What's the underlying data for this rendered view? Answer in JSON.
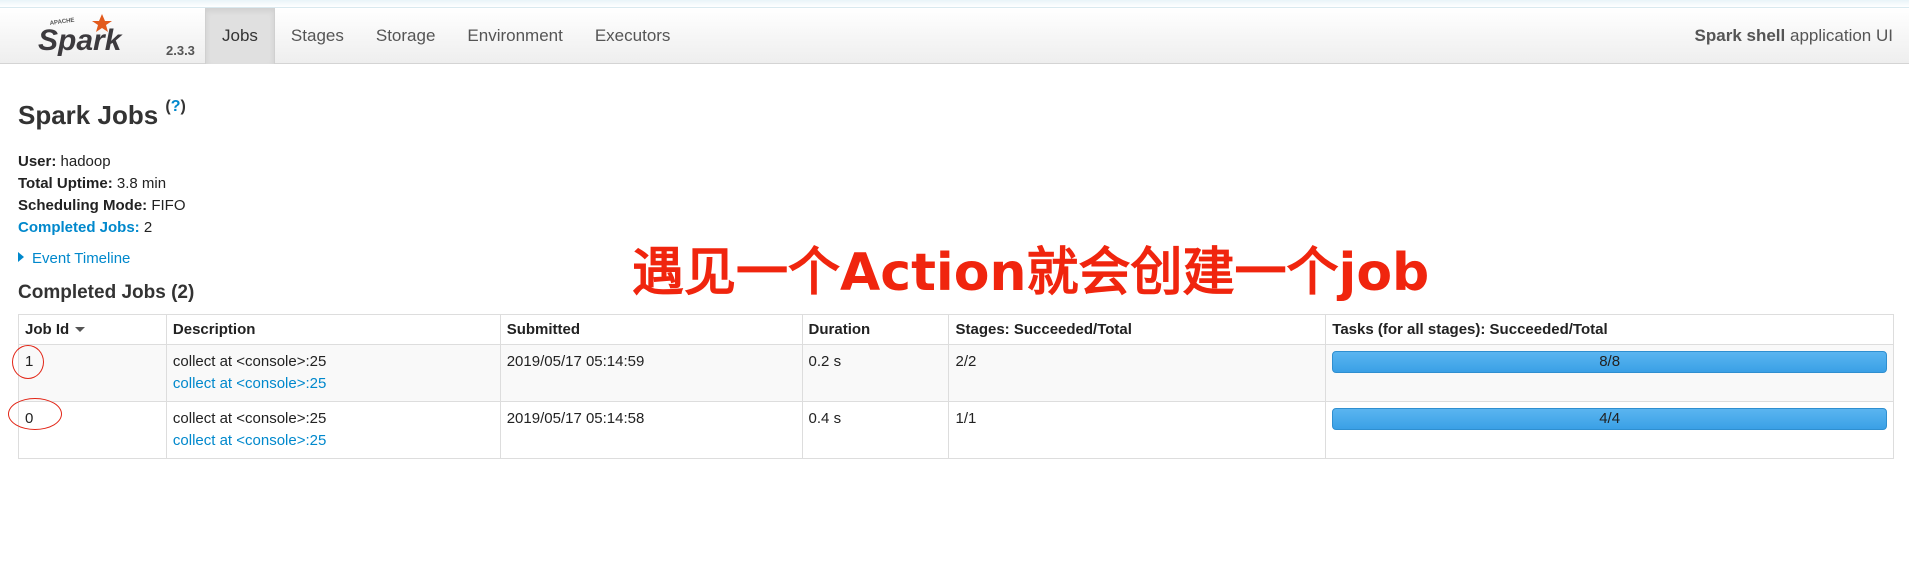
{
  "navbar": {
    "brand_label": "Spark",
    "brand_top_label": "APACHE",
    "version": "2.3.3",
    "tabs": [
      {
        "label": "Jobs",
        "active": true
      },
      {
        "label": "Stages",
        "active": false
      },
      {
        "label": "Storage",
        "active": false
      },
      {
        "label": "Environment",
        "active": false
      },
      {
        "label": "Executors",
        "active": false
      }
    ],
    "app_name": "Spark shell",
    "app_suffix": "application UI"
  },
  "page": {
    "title": "Spark Jobs",
    "help": "?"
  },
  "summary": {
    "user_key": "User:",
    "user_val": "hadoop",
    "uptime_key": "Total Uptime:",
    "uptime_val": "3.8 min",
    "sched_key": "Scheduling Mode:",
    "sched_val": "FIFO",
    "completed_key": "Completed Jobs:",
    "completed_val": "2"
  },
  "timeline": {
    "label": "Event Timeline"
  },
  "annotation": "遇见一个Action就会创建一个job",
  "completed_section": {
    "title": "Completed Jobs (2)"
  },
  "table": {
    "headers": [
      "Job Id",
      "Description",
      "Submitted",
      "Duration",
      "Stages: Succeeded/Total",
      "Tasks (for all stages): Succeeded/Total"
    ],
    "rows": [
      {
        "job_id": "1",
        "desc_text": "collect at <console>:25",
        "desc_link": "collect at <console>:25",
        "submitted": "2019/05/17 05:14:59",
        "duration": "0.2 s",
        "stages": "2/2",
        "tasks": "8/8",
        "tasks_fraction": 1.0
      },
      {
        "job_id": "0",
        "desc_text": "collect at <console>:25",
        "desc_link": "collect at <console>:25",
        "submitted": "2019/05/17 05:14:58",
        "duration": "0.4 s",
        "stages": "1/1",
        "tasks": "4/4",
        "tasks_fraction": 1.0
      }
    ]
  },
  "colors": {
    "link": "#0088cc",
    "annotation": "#f0250e",
    "progress": "#3aa0e6",
    "brand_orange": "#e25a1c"
  }
}
